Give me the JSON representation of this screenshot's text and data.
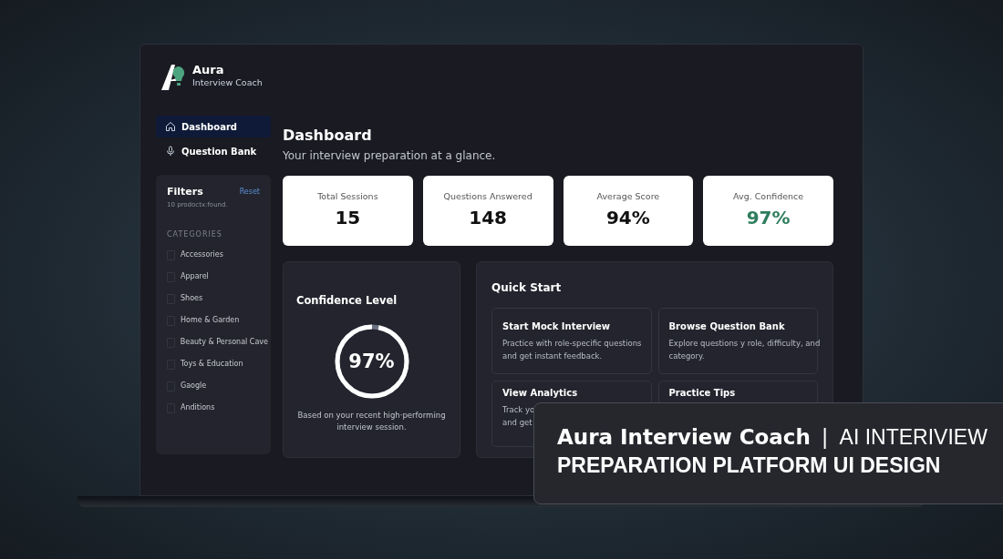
{
  "brand": {
    "name": "Aura",
    "tagline": "Interview Coach"
  },
  "nav": [
    {
      "label": "Dashboard",
      "kind": "home",
      "selected": true
    },
    {
      "label": "Question Bank",
      "kind": "mic",
      "selected": false
    }
  ],
  "filters": {
    "title": "Filters",
    "reset": "Reset",
    "count": "10 prodoctx:found.",
    "section": "CATEGORIES",
    "categories": [
      "Accessories",
      "Apparel",
      "Shoes",
      "Home & Garden",
      "Beauty & Personal Cave",
      "Toys & Education",
      "Gaogle",
      "Anditions"
    ]
  },
  "header": {
    "title": "Dashboard",
    "subtitle": "Your interview preparation at a glance."
  },
  "stats": [
    {
      "label": "Total Sessions",
      "value": "15",
      "accent": false
    },
    {
      "label": "Questions Answered",
      "value": "148",
      "accent": false
    },
    {
      "label": "Average Score",
      "value": "94%",
      "accent": false
    },
    {
      "label": "Avg. Confidence",
      "value": "97%",
      "accent": true
    }
  ],
  "confidence": {
    "title": "Confidence Level",
    "value": "97%",
    "level": 0.97,
    "note": "Based on your recent high·performing interview session."
  },
  "quick_start": {
    "title": "Quick Start",
    "cards": [
      {
        "title": "Start Mock Interview",
        "lines": [
          "Practice with role-specific questions",
          "and get instant feedback."
        ]
      },
      {
        "title": "Browse Question Bank",
        "lines": [
          "Explore questions y role, difficulty, and",
          "category."
        ]
      },
      {
        "title": "View Analytics",
        "lines": [
          "Track yo",
          "and get"
        ]
      },
      {
        "title": "Practice Tips"
      }
    ]
  },
  "banner": {
    "title": "Aura Interview Coach",
    "divider": "|",
    "kicker": "AI INTERIVIEW",
    "subtitle": "PREPARATION PLATFORM UI DESIGN"
  }
}
